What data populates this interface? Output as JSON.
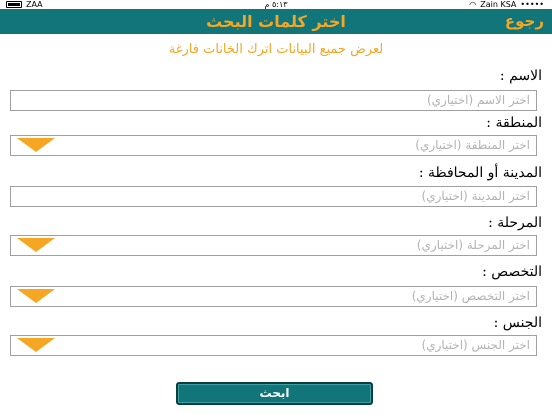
{
  "status_bar": {
    "signal": "ZAA",
    "time": "٥:١٣ م",
    "carrier": "Zain KSA"
  },
  "nav": {
    "title": "اختر كلمات البحث",
    "back_label": "رجوع",
    "background_color": "#11757a",
    "accent_color": "#f5a623"
  },
  "hint": "لعرض جميع البيانات اترك الخانات فارغة",
  "fields": [
    {
      "label": "الاسم :",
      "placeholder": "اختر الاسم (اختياري)",
      "type": "text"
    },
    {
      "label": "المنطقة :",
      "placeholder": "اختر المنطقة (اختياري)",
      "type": "dropdown"
    },
    {
      "label": "المدينة أو المحافظة :",
      "placeholder": "اختر المدينة (اختياري)",
      "type": "text"
    },
    {
      "label": "المرحلة :",
      "placeholder": "اختر المرحلة (اختياري)",
      "type": "dropdown"
    },
    {
      "label": "التخصص :",
      "placeholder": "اختر التخصص (اختياري)",
      "type": "dropdown"
    },
    {
      "label": "الجنس :",
      "placeholder": "اختر الجنس (اختياري)",
      "type": "dropdown"
    }
  ],
  "search_button": "ابحث"
}
